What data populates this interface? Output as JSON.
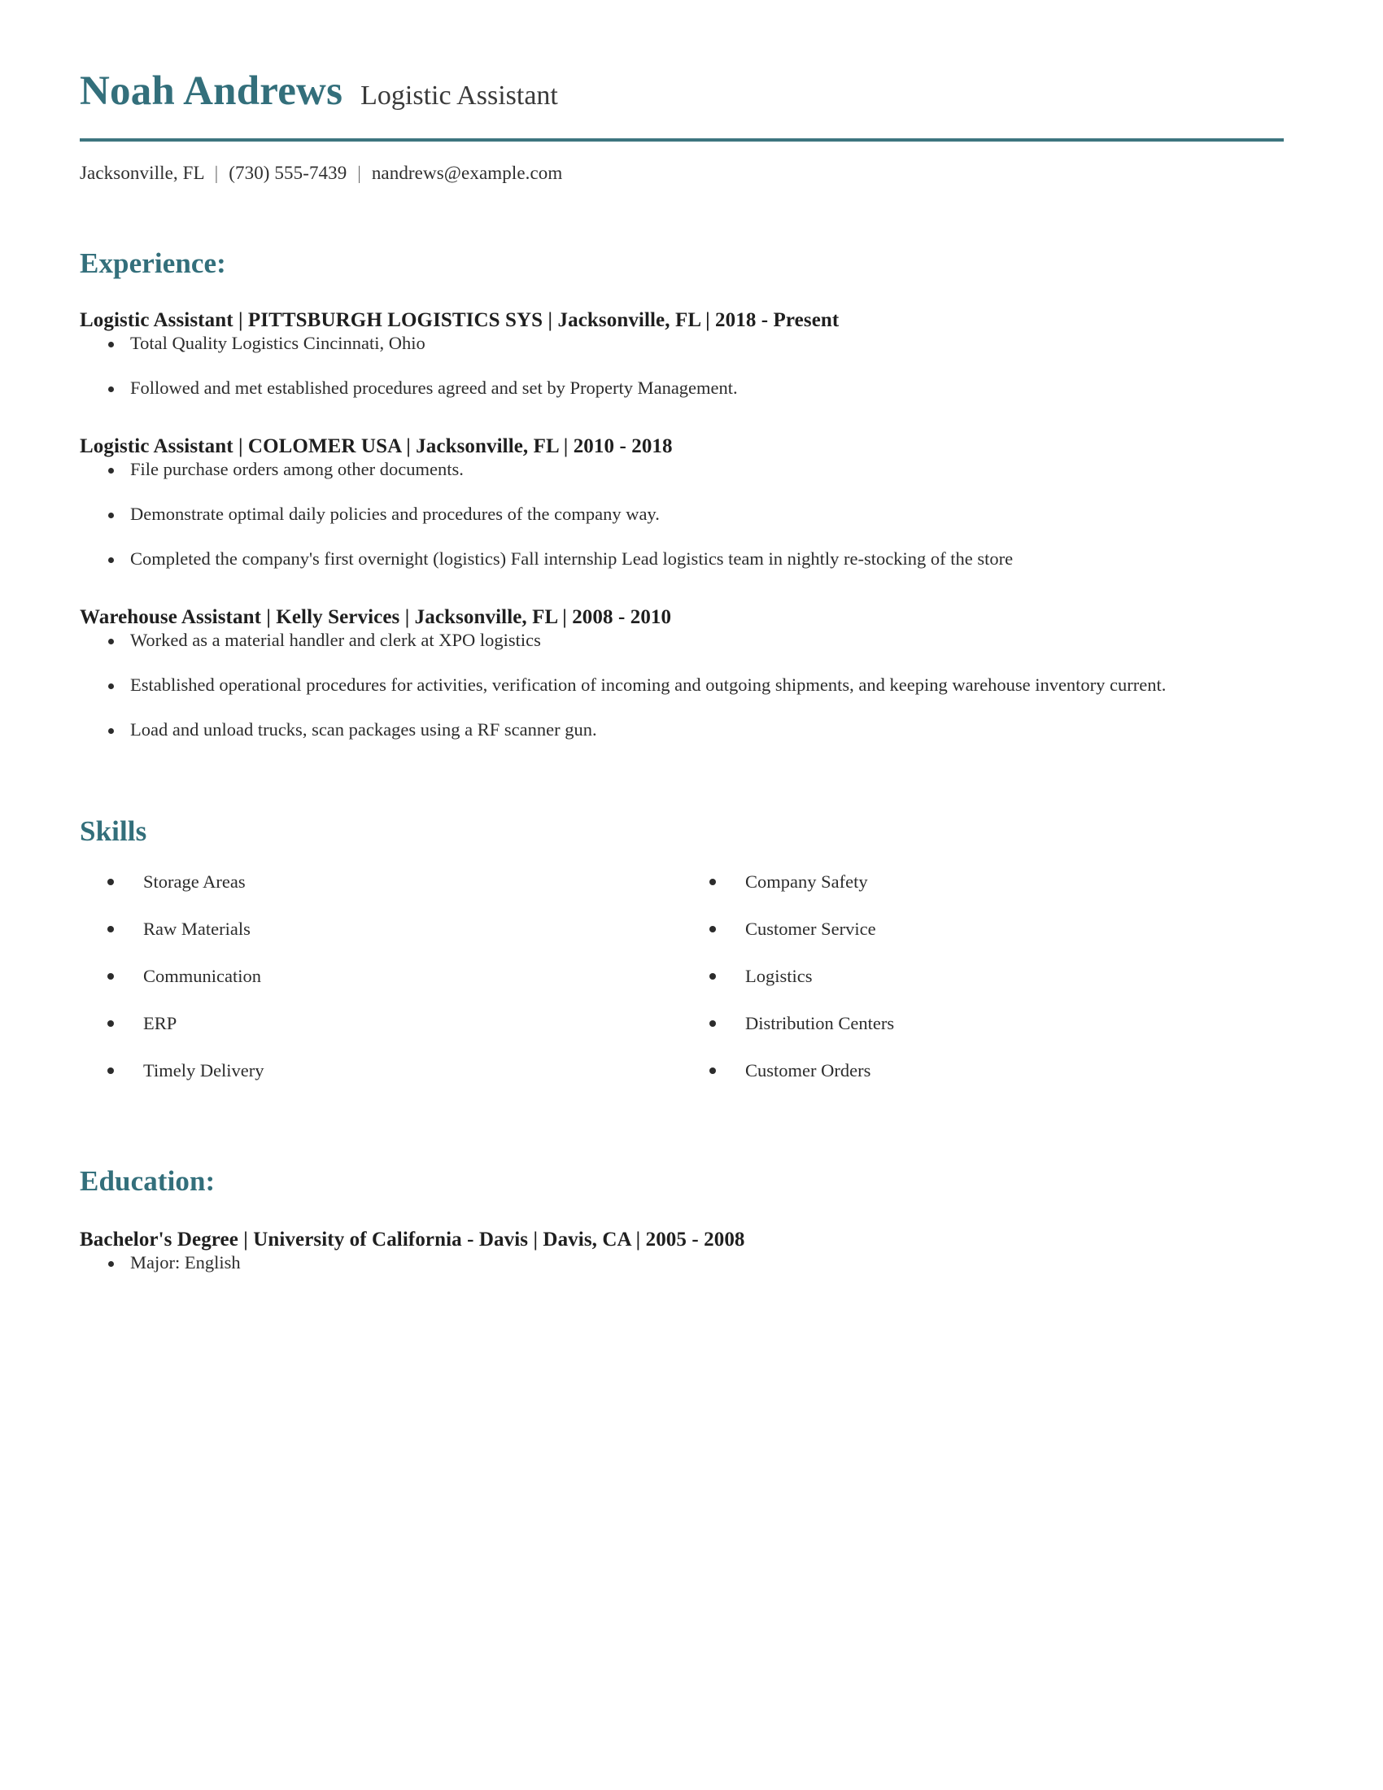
{
  "theme": {
    "accent": "#336f7b",
    "rule": "#3d757f",
    "text": "#2c2c2c",
    "heading_text": "#1f1f1f",
    "background": "#ffffff"
  },
  "header": {
    "name": "Noah Andrews",
    "job_title": "Logistic Assistant",
    "contact": {
      "location": "Jacksonville, FL",
      "separator": "|",
      "phone": "(730) 555-7439",
      "email": "nandrews@example.com"
    }
  },
  "experience": {
    "heading": "Experience:",
    "entries": [
      {
        "title": "Logistic Assistant | PITTSBURGH LOGISTICS SYS | Jacksonville, FL |  2018 - Present",
        "bullets": [
          "Total Quality Logistics Cincinnati, Ohio",
          "Followed and met established procedures agreed and set by Property Management."
        ]
      },
      {
        "title": "Logistic Assistant | COLOMER USA | Jacksonville, FL |  2010 - 2018",
        "bullets": [
          "File purchase orders among other documents.",
          "Demonstrate optimal daily policies and procedures of the company way.",
          "Completed the company's first overnight (logistics) Fall internship Lead logistics team in nightly re-stocking of the store"
        ]
      },
      {
        "title": "Warehouse Assistant | Kelly Services | Jacksonville, FL |  2008 - 2010",
        "bullets": [
          "Worked as a material handler and clerk at XPO logistics",
          "Established operational procedures for activities, verification of incoming and outgoing shipments, and keeping warehouse inventory current.",
          "Load and unload trucks, scan packages using a RF scanner gun."
        ]
      }
    ]
  },
  "skills": {
    "heading": "Skills",
    "left_column": [
      "Storage Areas",
      "Raw Materials",
      "Communication",
      "ERP",
      "Timely Delivery"
    ],
    "right_column": [
      "Company Safety",
      "Customer Service",
      "Logistics",
      "Distribution Centers",
      "Customer Orders"
    ]
  },
  "education": {
    "heading": "Education:",
    "entries": [
      {
        "title": "Bachelor's Degree | University of California - Davis | Davis, CA |  2005 - 2008",
        "bullets": [
          "Major: English"
        ]
      }
    ]
  }
}
